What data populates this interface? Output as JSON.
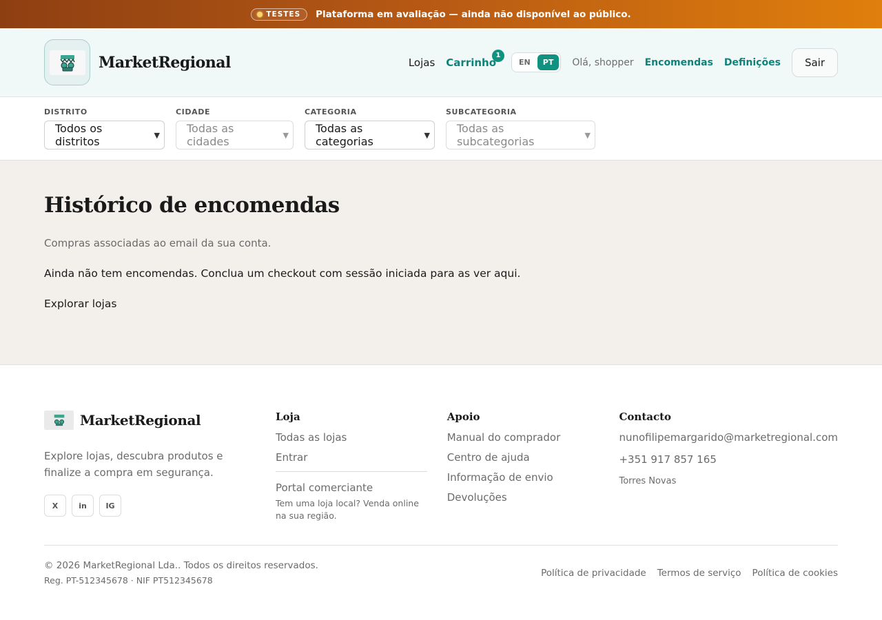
{
  "banner": {
    "badge": "TESTES",
    "text": "Plataforma em avaliação — ainda não disponível ao público."
  },
  "header": {
    "brand": "MarketRegional",
    "nav": {
      "stores": "Lojas",
      "cart": "Carrinho",
      "cart_count": "1",
      "lang_en": "EN",
      "lang_pt": "PT",
      "greeting": "Olá, shopper",
      "orders": "Encomendas",
      "settings": "Definições",
      "logout": "Sair"
    }
  },
  "filters": {
    "district": {
      "label": "DISTRITO",
      "value": "Todos os distritos"
    },
    "city": {
      "label": "CIDADE",
      "value": "Todas as cidades"
    },
    "category": {
      "label": "CATEGORIA",
      "value": "Todas as categorias"
    },
    "subcategory": {
      "label": "SUBCATEGORIA",
      "value": "Todas as subcategorias"
    }
  },
  "main": {
    "title": "Histórico de encomendas",
    "subtitle": "Compras associadas ao email da sua conta.",
    "empty": "Ainda não tem encomendas. Conclua um checkout com sessão iniciada para as ver aqui.",
    "explore": "Explorar lojas"
  },
  "footer": {
    "brand": "MarketRegional",
    "description": "Explore lojas, descubra produtos e finalize a compra em segurança.",
    "socials": [
      "X",
      "in",
      "IG"
    ],
    "store": {
      "heading": "Loja",
      "links": [
        "Todas as lojas",
        "Entrar"
      ],
      "portal": "Portal comerciante",
      "portal_sub": "Tem uma loja local? Venda online na sua região."
    },
    "support": {
      "heading": "Apoio",
      "links": [
        "Manual do comprador",
        "Centro de ajuda",
        "Informação de envio",
        "Devoluções"
      ]
    },
    "contact": {
      "heading": "Contacto",
      "email": "nunofilipemargarido@marketregional.com",
      "phone": "+351 917 857 165",
      "city": "Torres Novas"
    },
    "copyright": "© 2026 MarketRegional Lda.. Todos os direitos reservados.",
    "registration": "Reg. PT-512345678 · NIF PT512345678",
    "legal": [
      "Política de privacidade",
      "Termos de serviço",
      "Política de cookies"
    ]
  }
}
